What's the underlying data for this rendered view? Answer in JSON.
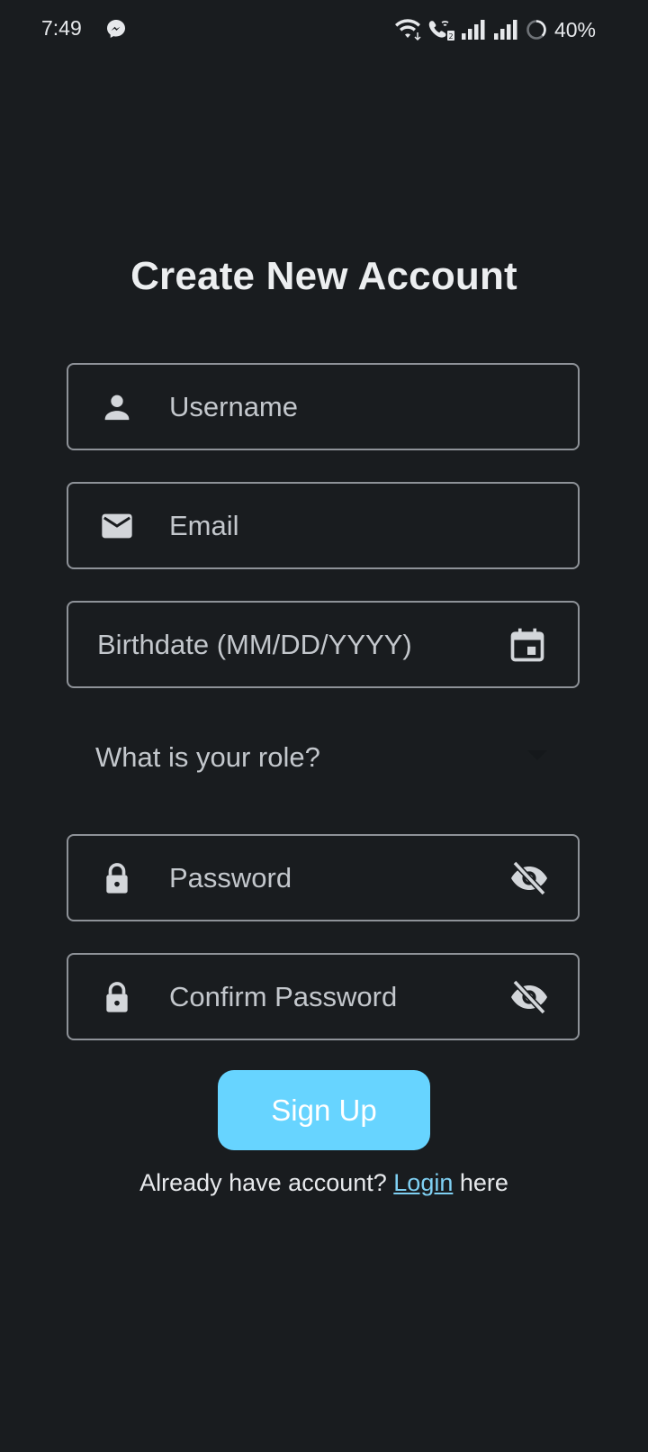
{
  "status_bar": {
    "time": "7:49",
    "battery": "40%",
    "icons": [
      "messenger-icon",
      "wifi-icon",
      "wifi-calling-icon",
      "signal-icon",
      "signal-icon",
      "battery-saver-icon"
    ]
  },
  "title": "Create New Account",
  "form": {
    "username": {
      "placeholder": "Username",
      "icon": "person-icon"
    },
    "email": {
      "placeholder": "Email",
      "icon": "mail-icon"
    },
    "birthdate": {
      "placeholder": "Birthdate (MM/DD/YYYY)",
      "icon": "calendar-icon"
    },
    "role": {
      "placeholder": "What is your role?",
      "icon": "dropdown-arrow-icon"
    },
    "password": {
      "placeholder": "Password",
      "icon": "lock-icon",
      "toggle_icon": "visibility-off-icon"
    },
    "confirm_password": {
      "placeholder": "Confirm Password",
      "icon": "lock-icon",
      "toggle_icon": "visibility-off-icon"
    }
  },
  "signup_button": "Sign Up",
  "footer": {
    "prefix": "Already have account?",
    "login_link": "Login",
    "suffix": "here"
  },
  "colors": {
    "background": "#191c1f",
    "field_border": "#8e9298",
    "accent": "#67d4ff",
    "link": "#7fd0f3"
  }
}
